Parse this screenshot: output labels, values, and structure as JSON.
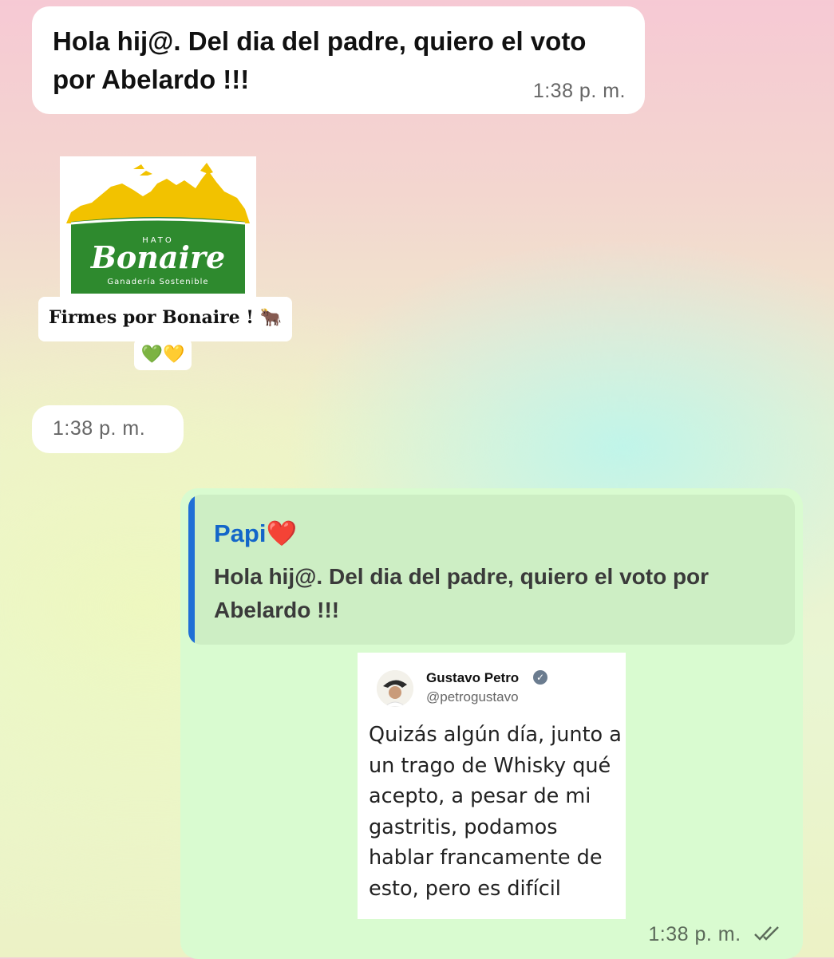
{
  "incoming_message": {
    "text": "Hola hij@. Del dia del padre, quiero el voto por Abelardo !!!",
    "time": "1:38 p. m."
  },
  "sticker": {
    "logo_small_text": "HATO",
    "logo_brand": "Bonaire",
    "logo_tagline": "Ganadería Sostenible",
    "caption": "Firmes por Bonaire ! 🐂",
    "hearts": "💚💛"
  },
  "sticker_message": {
    "time": "1:38 p. m."
  },
  "outgoing_message": {
    "quoted_author": "Papi❤️",
    "quoted_text": "Hola hij@. Del dia del padre, quiero el voto por Abelardo !!!",
    "tweet": {
      "name": "Gustavo Petro",
      "handle": "@petrogustavo",
      "body": "Quizás algún día, junto a un trago de Whisky qué acepto, a pesar de mi  gastritis, podamos hablar francamente de esto, pero es difícil"
    },
    "time": "1:38 p. m.",
    "status_icon": "double-check-icon"
  },
  "colors": {
    "outgoing_bubble": "#d9fbd0",
    "quote_bar": "#1f6fd6",
    "quote_author": "#1366c9",
    "logo_green": "#2e8a2e",
    "logo_yellow": "#f2c200"
  }
}
